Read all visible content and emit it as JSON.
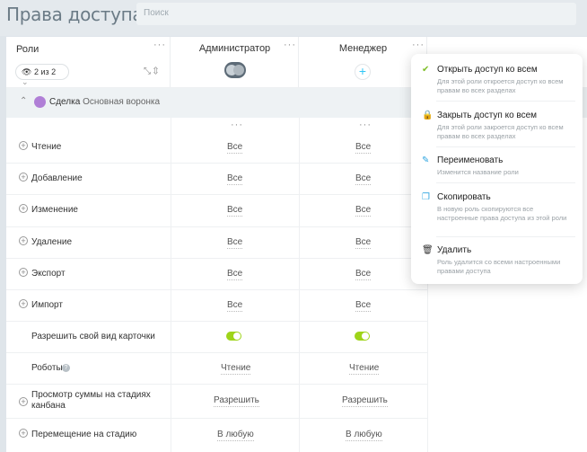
{
  "header": {
    "title": "Права доступа",
    "search_placeholder": "Поиск"
  },
  "table": {
    "roles_label": "Роли",
    "filter_label": "2 из 2",
    "columns": [
      {
        "name": "Администратор",
        "menu": "···"
      },
      {
        "name": "Менеджер",
        "menu": "···",
        "add": "+"
      }
    ],
    "section": {
      "entity": "Сделка",
      "pipeline": "Основная воронка"
    },
    "rows": [
      {
        "label": "Чтение",
        "admin": "Все",
        "manager": "Все"
      },
      {
        "label": "Добавление",
        "admin": "Все",
        "manager": "Все"
      },
      {
        "label": "Изменение",
        "admin": "Все",
        "manager": "Все"
      },
      {
        "label": "Удаление",
        "admin": "Все",
        "manager": "Все"
      },
      {
        "label": "Экспорт",
        "admin": "Все",
        "manager": "Все"
      },
      {
        "label": "Импорт",
        "admin": "Все",
        "manager": "Все"
      },
      {
        "label": "Разрешить свой вид карточки"
      },
      {
        "label": "Роботы",
        "admin": "Чтение",
        "manager": "Чтение"
      },
      {
        "label": "Просмотр суммы на стадиях канбана",
        "admin": "Разрешить",
        "manager": "Разрешить"
      },
      {
        "label": "Перемещение на стадию",
        "admin": "В любую",
        "manager": "В любую"
      }
    ]
  },
  "menu": {
    "items": [
      {
        "title": "Открыть доступ ко всем",
        "desc": "Для этой роли откроется доступ ко всем правам во всех разделах",
        "icon": "check-icon",
        "color": "#7fbf2a"
      },
      {
        "title": "Закрыть доступ ко всем",
        "desc": "Для этой роли закроется доступ ко всем правам во всех разделах",
        "icon": "lock-icon",
        "color": "#e0453b"
      },
      {
        "title": "Переименовать",
        "desc": "Изменится название роли",
        "icon": "pencil-icon",
        "color": "#2fa5e0"
      },
      {
        "title": "Скопировать",
        "desc": "В новую роль скопируются все настроенные права доступа из этой роли",
        "icon": "copy-icon",
        "color": "#2fa5e0"
      },
      {
        "title": "Удалить",
        "desc": "Роль удалится со всеми настроенными правами доступа",
        "icon": "trash-icon",
        "color": "#333333"
      }
    ]
  }
}
